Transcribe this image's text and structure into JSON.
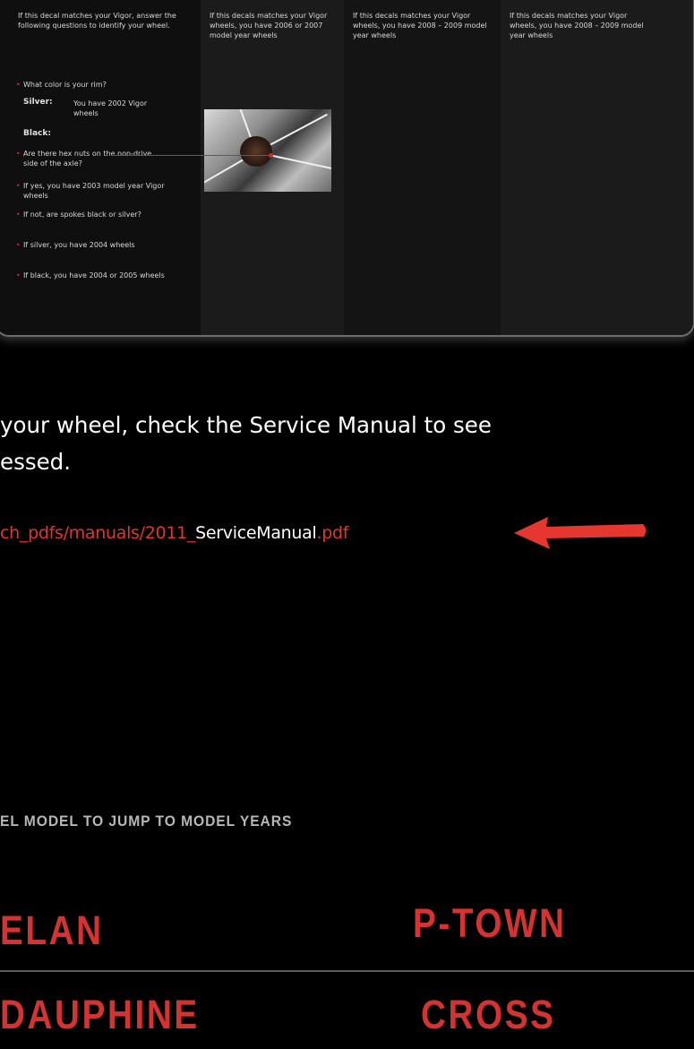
{
  "chart_panel": {
    "col1": {
      "intro": "If this decal matches your Vigor, answer the following questions to identify your wheel.",
      "q_color": "What color is your rim?",
      "silver_label": "Silver:",
      "silver_text": "You have 2002 Vigor wheels",
      "black_label": "Black:",
      "b1": "Are there hex nuts on the non-drive side of the axle?",
      "b2": "If yes, you have 2003 model year Vigor wheels",
      "b3": "If not, are spokes black or silver?",
      "b4": "If silver, you have 2004 wheels",
      "b5": "If black, you have 2004 or 2005 wheels"
    },
    "col2": "If this decals matches your Vigor wheels, you have 2006 or 2007 model year wheels",
    "col3": "If this decals matches your Vigor wheels, you have 2008 – 2009 model year wheels",
    "col4": "If this decals matches your Vigor wheels, you have 2008 – 2009 model year wheels"
  },
  "lead_line1": "your wheel, check the Service Manual to see",
  "lead_line2": "essed.",
  "link": {
    "red_part1": "ch_pdfs/manuals/2011_",
    "white_part": "ServiceManual",
    "red_part2": ".pdf"
  },
  "jump_heading": "EL MODEL TO JUMP TO MODEL YEARS",
  "models": [
    "ELAN",
    "P-TOWN",
    "DAUPHINE",
    "CROSS"
  ],
  "colors": {
    "accent_red": "#d53232",
    "link_red": "#e23531",
    "background": "#000000"
  },
  "icons": {
    "arrow": "red-left-arrow-icon"
  }
}
